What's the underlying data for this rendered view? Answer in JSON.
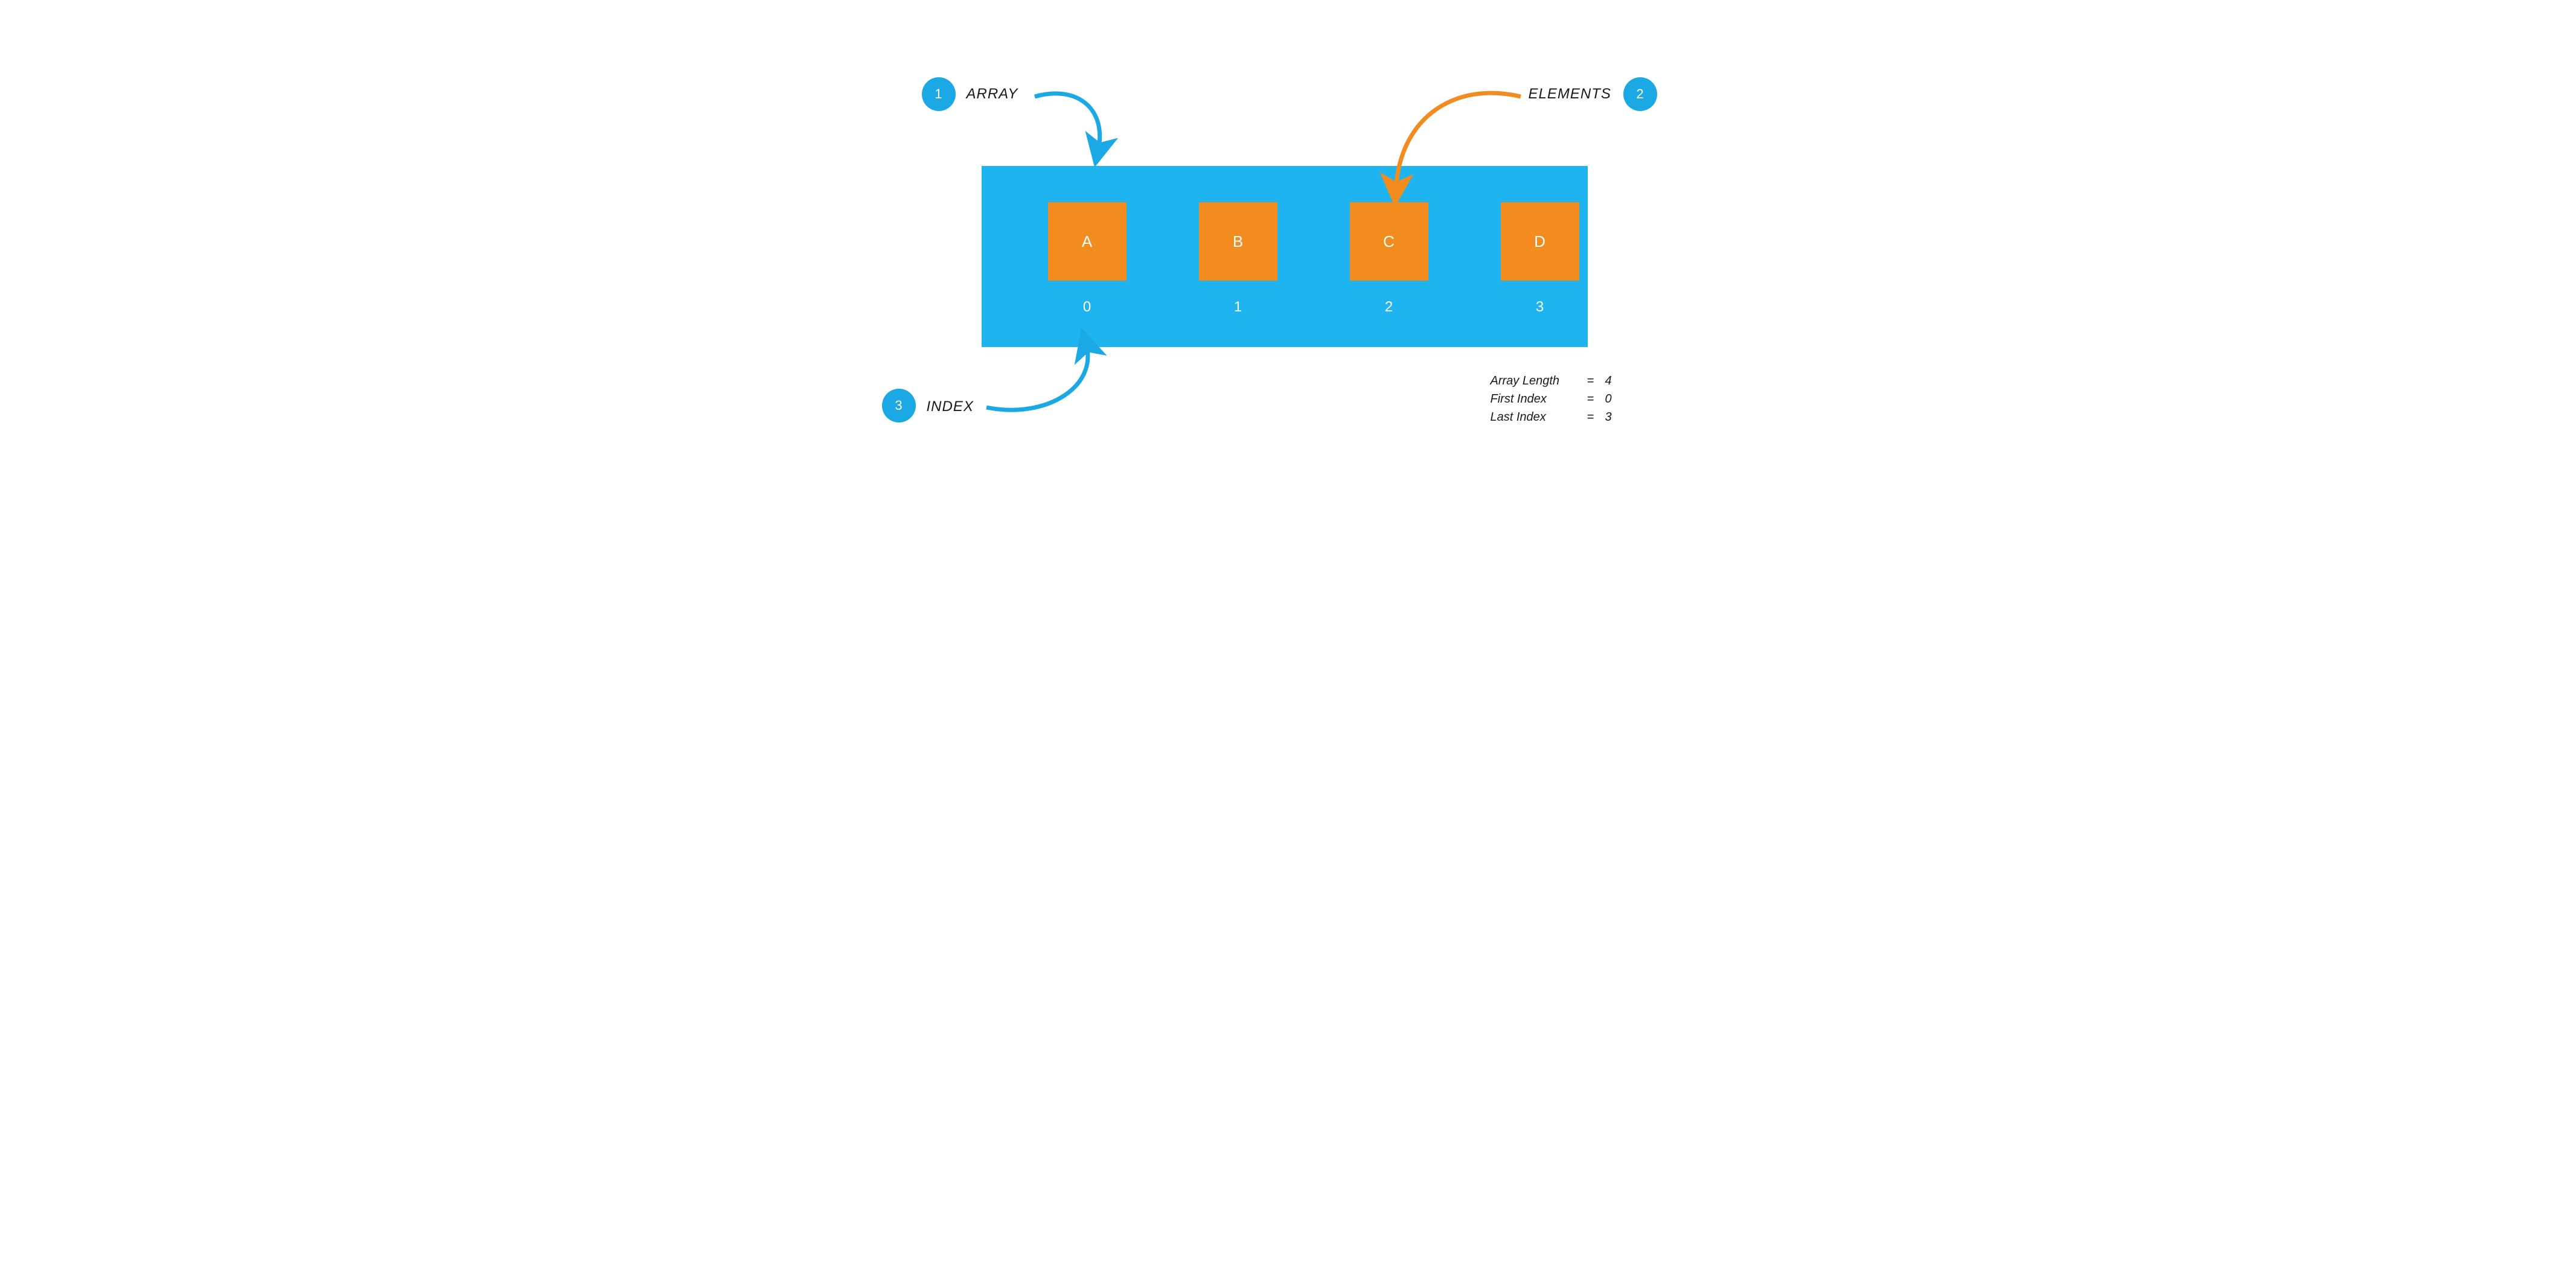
{
  "badges": {
    "one": "1",
    "two": "2",
    "three": "3"
  },
  "labels": {
    "array": "ARRAY",
    "elements": "ELEMENTS",
    "index": "INDEX"
  },
  "elements": [
    {
      "value": "A",
      "index": "0"
    },
    {
      "value": "B",
      "index": "1"
    },
    {
      "value": "C",
      "index": "2"
    },
    {
      "value": "D",
      "index": "3"
    }
  ],
  "info": {
    "length_label": "Array Length",
    "length_value": "4",
    "first_label": "First Index",
    "first_value": "0",
    "last_label": "Last Index",
    "last_value": "3",
    "eq": "="
  },
  "colors": {
    "blue": "#1ba9e6",
    "lightblue": "#1db4ef",
    "orange": "#f28c1e"
  }
}
